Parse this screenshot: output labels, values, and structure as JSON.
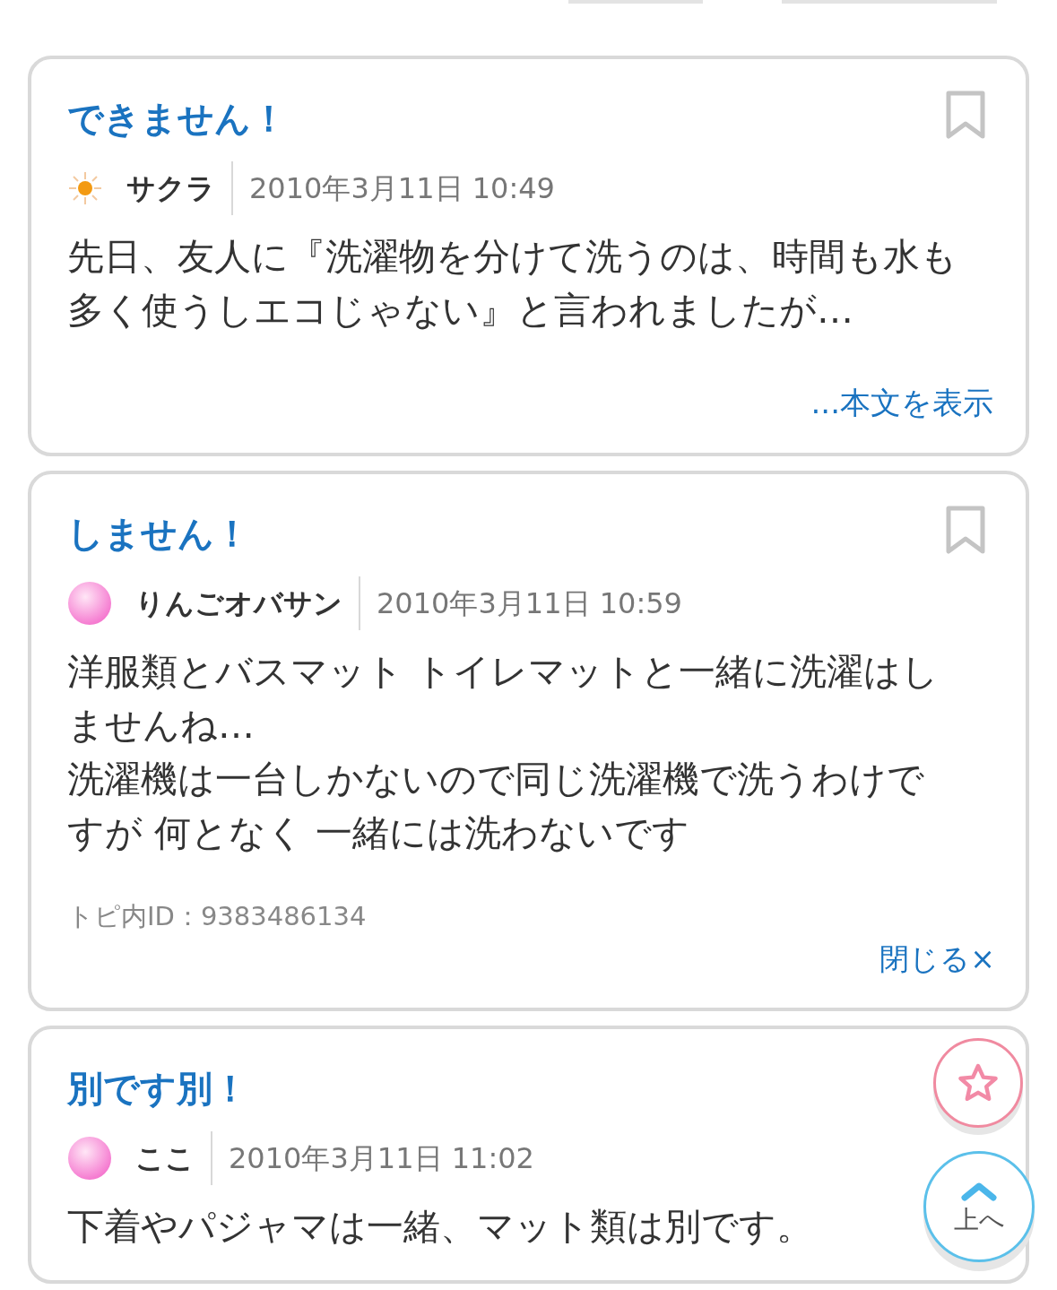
{
  "posts": [
    {
      "title": "できません！",
      "bookmark": true,
      "avatar": {
        "kind": "sun"
      },
      "author": "サクラ",
      "date": "2010年3月11日 10:49",
      "body": [
        "先日、友人に『洗濯物を分けて洗うのは、時間も水も多く使うしエコじゃない』と言われましたが…"
      ],
      "expand_link": "...本文を表示"
    },
    {
      "title": "しません！",
      "bookmark": true,
      "avatar": {
        "kind": "ball"
      },
      "author": "りんごオバサン",
      "date": "2010年3月11日 10:59",
      "body": [
        "洋服類とバスマット トイレマットと一緒に洗濯はしませんね…",
        "洗濯機は一台しかないので同じ洗濯機で洗うわけですが 何となく 一緒には洗わないです"
      ],
      "topic_id": "トピ内ID：9383486134",
      "close_link": "閉じる×"
    },
    {
      "title": "別です別！",
      "avatar": {
        "kind": "ball"
      },
      "author": "ここ",
      "date": "2010年3月11日 11:02",
      "body": [
        "下着やパジャマは一緒、マット類は別です。"
      ]
    }
  ],
  "scroll_top_button": "上へ"
}
